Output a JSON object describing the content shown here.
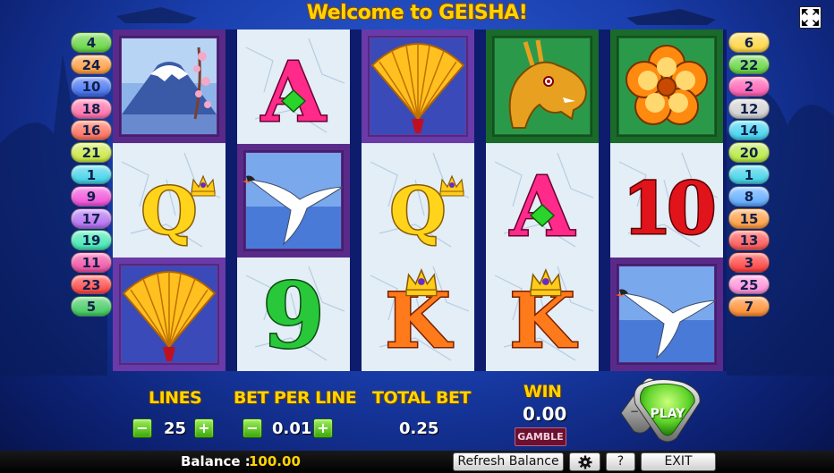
{
  "game": {
    "title": "Welcome to GEISHA!"
  },
  "paylines": {
    "left": [
      {
        "n": "4",
        "color": "#5fd43a"
      },
      {
        "n": "24",
        "color": "#ff9a3a"
      },
      {
        "n": "10",
        "color": "#3c6cf0"
      },
      {
        "n": "18",
        "color": "#ff6aa6"
      },
      {
        "n": "16",
        "color": "#ff6a55"
      },
      {
        "n": "21",
        "color": "#c8e83a"
      },
      {
        "n": "1",
        "color": "#3ad2e8"
      },
      {
        "n": "9",
        "color": "#f04ad8"
      },
      {
        "n": "17",
        "color": "#b06af0"
      },
      {
        "n": "19",
        "color": "#3ae8b0"
      },
      {
        "n": "11",
        "color": "#f04aa0"
      },
      {
        "n": "23",
        "color": "#ff4040"
      },
      {
        "n": "5",
        "color": "#3ac85a"
      }
    ],
    "right": [
      {
        "n": "6",
        "color": "#ffd43a"
      },
      {
        "n": "22",
        "color": "#5fd43a"
      },
      {
        "n": "2",
        "color": "#ff5ab0"
      },
      {
        "n": "12",
        "color": "#d0d0d0"
      },
      {
        "n": "14",
        "color": "#3ad2f0"
      },
      {
        "n": "20",
        "color": "#b4e83a"
      },
      {
        "n": "1",
        "color": "#3ad2e8"
      },
      {
        "n": "8",
        "color": "#5aa8ff"
      },
      {
        "n": "15",
        "color": "#ff9a3a"
      },
      {
        "n": "13",
        "color": "#ff5050"
      },
      {
        "n": "3",
        "color": "#ff3a3a"
      },
      {
        "n": "25",
        "color": "#ff8ad8"
      },
      {
        "n": "7",
        "color": "#ff8a2a"
      }
    ]
  },
  "reels": [
    [
      "mount-fuji",
      "queen",
      "fan"
    ],
    [
      "ace",
      "crane",
      "nine"
    ],
    [
      "fan",
      "queen",
      "king"
    ],
    [
      "dragon",
      "ace",
      "king"
    ],
    [
      "flower",
      "ten",
      "crane"
    ]
  ],
  "symbol_text": {
    "ace": "A",
    "queen": "Q",
    "king": "K",
    "nine": "9",
    "ten": "10"
  },
  "controls": {
    "lines_label": "LINES",
    "lines_value": "25",
    "bet_label": "BET PER LINE",
    "bet_value": "0.01",
    "total_label": "TOTAL BET",
    "total_value": "0.25",
    "win_label": "WIN",
    "win_value": "0.00",
    "gamble_label": "GAMBLE",
    "play_label": "PLAY",
    "minus_icon": "minus-icon",
    "plus_icon": "plus-icon"
  },
  "status": {
    "balance_label": "Balance :",
    "balance_value": "100.00",
    "refresh_label": "Refresh Balance",
    "help_label": "?",
    "exit_label": "EXIT",
    "settings_icon": "gear-icon"
  },
  "colors": {
    "title": "#ffd400",
    "accent_green": "#5fd43a",
    "gamble_bg": "#6a1030"
  }
}
